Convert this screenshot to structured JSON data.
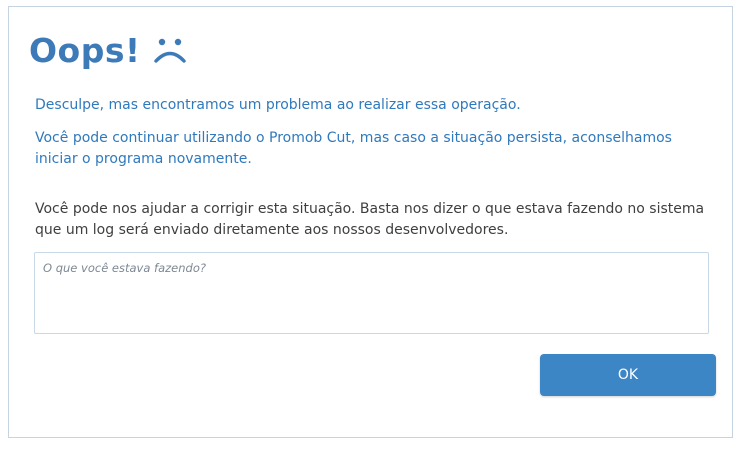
{
  "dialog": {
    "title": "Oops!",
    "title_icon": "sad-face-icon",
    "message_1": "Desculpe, mas encontramos um problema ao realizar essa operação.",
    "message_2": "Você pode continuar utilizando o Promob Cut, mas caso a situação persista, aconselhamos iniciar o programa novamente.",
    "message_3": "Você pode nos ajudar a corrigir esta situação. Basta nos dizer o que estava fazendo no sistema que um log será enviado diretamente aos nossos desenvolvedores.",
    "feedback": {
      "value": "",
      "placeholder": "O que você estava fazendo?"
    },
    "ok_label": "OK"
  },
  "colors": {
    "accent": "#3d7ab8",
    "link_text": "#2f79bd",
    "button_bg": "#3d86c6",
    "body_text": "#3f3f3f",
    "border": "#c5d3e2"
  }
}
